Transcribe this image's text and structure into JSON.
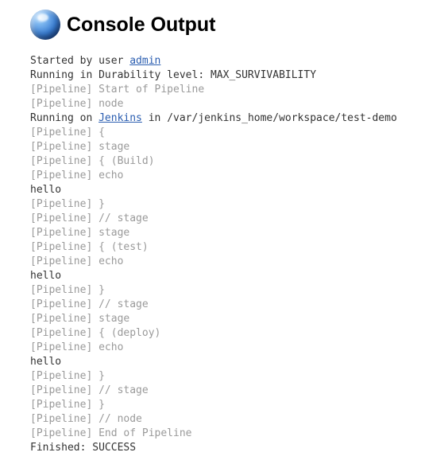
{
  "header": {
    "title": "Console Output"
  },
  "console": {
    "lines": [
      {
        "parts": [
          {
            "text": "Started by user ",
            "cls": "plain"
          },
          {
            "text": "admin",
            "cls": "link"
          }
        ]
      },
      {
        "parts": [
          {
            "text": "Running in Durability level: MAX_SURVIVABILITY",
            "cls": "plain"
          }
        ]
      },
      {
        "parts": [
          {
            "text": "[Pipeline] Start of Pipeline",
            "cls": "dim"
          }
        ]
      },
      {
        "parts": [
          {
            "text": "[Pipeline] node",
            "cls": "dim"
          }
        ]
      },
      {
        "parts": [
          {
            "text": "Running on ",
            "cls": "plain"
          },
          {
            "text": "Jenkins",
            "cls": "link"
          },
          {
            "text": " in /var/jenkins_home/workspace/test-demo",
            "cls": "plain"
          }
        ]
      },
      {
        "parts": [
          {
            "text": "[Pipeline] {",
            "cls": "dim"
          }
        ]
      },
      {
        "parts": [
          {
            "text": "[Pipeline] stage",
            "cls": "dim"
          }
        ]
      },
      {
        "parts": [
          {
            "text": "[Pipeline] { (Build)",
            "cls": "dim"
          }
        ]
      },
      {
        "parts": [
          {
            "text": "[Pipeline] echo",
            "cls": "dim"
          }
        ]
      },
      {
        "parts": [
          {
            "text": "hello",
            "cls": "plain"
          }
        ]
      },
      {
        "parts": [
          {
            "text": "[Pipeline] }",
            "cls": "dim"
          }
        ]
      },
      {
        "parts": [
          {
            "text": "[Pipeline] // stage",
            "cls": "dim"
          }
        ]
      },
      {
        "parts": [
          {
            "text": "[Pipeline] stage",
            "cls": "dim"
          }
        ]
      },
      {
        "parts": [
          {
            "text": "[Pipeline] { (test)",
            "cls": "dim"
          }
        ]
      },
      {
        "parts": [
          {
            "text": "[Pipeline] echo",
            "cls": "dim"
          }
        ]
      },
      {
        "parts": [
          {
            "text": "hello",
            "cls": "plain"
          }
        ]
      },
      {
        "parts": [
          {
            "text": "[Pipeline] }",
            "cls": "dim"
          }
        ]
      },
      {
        "parts": [
          {
            "text": "[Pipeline] // stage",
            "cls": "dim"
          }
        ]
      },
      {
        "parts": [
          {
            "text": "[Pipeline] stage",
            "cls": "dim"
          }
        ]
      },
      {
        "parts": [
          {
            "text": "[Pipeline] { (deploy)",
            "cls": "dim"
          }
        ]
      },
      {
        "parts": [
          {
            "text": "[Pipeline] echo",
            "cls": "dim"
          }
        ]
      },
      {
        "parts": [
          {
            "text": "hello",
            "cls": "plain"
          }
        ]
      },
      {
        "parts": [
          {
            "text": "[Pipeline] }",
            "cls": "dim"
          }
        ]
      },
      {
        "parts": [
          {
            "text": "[Pipeline] // stage",
            "cls": "dim"
          }
        ]
      },
      {
        "parts": [
          {
            "text": "[Pipeline] }",
            "cls": "dim"
          }
        ]
      },
      {
        "parts": [
          {
            "text": "[Pipeline] // node",
            "cls": "dim"
          }
        ]
      },
      {
        "parts": [
          {
            "text": "[Pipeline] End of Pipeline",
            "cls": "dim"
          }
        ]
      },
      {
        "parts": [
          {
            "text": "Finished: SUCCESS",
            "cls": "plain"
          }
        ]
      }
    ]
  }
}
